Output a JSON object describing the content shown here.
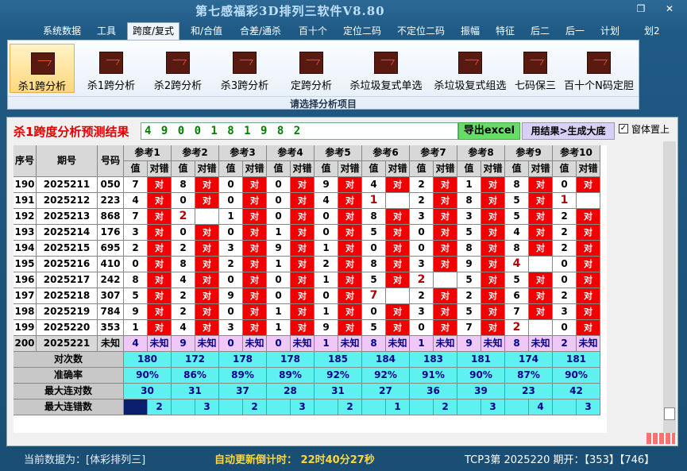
{
  "window": {
    "title": "第七感福彩3D排列三软件V8.80",
    "restore_glyph": "❐",
    "close_glyph": "✕"
  },
  "menu": [
    {
      "label": "系统数据",
      "active": false
    },
    {
      "label": "工具",
      "active": false
    },
    {
      "label": "跨度/复式",
      "active": true
    },
    {
      "label": "和/合值",
      "active": false
    },
    {
      "label": "合差/通杀",
      "active": false
    },
    {
      "label": "百十个",
      "active": false
    },
    {
      "label": "定位二码",
      "active": false
    },
    {
      "label": "不定位二码",
      "active": false
    },
    {
      "label": "振幅",
      "active": false
    },
    {
      "label": "特征",
      "active": false
    },
    {
      "label": "后二",
      "active": false
    },
    {
      "label": "后一",
      "active": false
    },
    {
      "label": "计划",
      "active": false
    },
    {
      "label": "划2",
      "active": false
    }
  ],
  "ribbon": {
    "buttons": [
      "杀1跨分析",
      "杀1跨分析",
      "杀2跨分析",
      "杀3跨分析",
      "定跨分析",
      "杀垃圾复式单选",
      "杀垃圾复式组选",
      "七码保三",
      "百十个N码定胆"
    ],
    "caption": "请选择分析项目"
  },
  "analysis": {
    "title": "杀1跨度分析预测结果",
    "prediction": "4 9 0 0 1 8 1 9 8 2",
    "excel_button": "导出excel",
    "generate_button": "用结果>生成大底",
    "pin_label": "窗体置上",
    "pin_checked": true,
    "pin_checkmark": "✓"
  },
  "table": {
    "headers": {
      "seq": "序号",
      "period": "期号",
      "number": "号码",
      "value": "值",
      "hit": "对错"
    },
    "ref_groups": [
      "参考1",
      "参考2",
      "参考3",
      "参考4",
      "参考5",
      "参考6",
      "参考7",
      "参考8",
      "参考9",
      "参考10"
    ],
    "hit_text": "对",
    "rows": [
      {
        "seq": "190",
        "period": "2025211",
        "num": "050",
        "v": [
          "7",
          "8",
          "0",
          "0",
          "9",
          "4",
          "2",
          "1",
          "8",
          "0"
        ],
        "h": [
          1,
          1,
          1,
          1,
          1,
          1,
          1,
          1,
          1,
          1
        ]
      },
      {
        "seq": "191",
        "period": "2025212",
        "num": "223",
        "v": [
          "4",
          "0",
          "0",
          "0",
          "4",
          "1",
          "2",
          "8",
          "5",
          "1"
        ],
        "h": [
          1,
          1,
          1,
          1,
          1,
          0,
          1,
          1,
          1,
          0
        ]
      },
      {
        "seq": "192",
        "period": "2025213",
        "num": "868",
        "v": [
          "7",
          "2",
          "1",
          "0",
          "0",
          "8",
          "3",
          "3",
          "5",
          "2"
        ],
        "h": [
          1,
          0,
          1,
          1,
          1,
          1,
          1,
          1,
          1,
          1
        ]
      },
      {
        "seq": "193",
        "period": "2025214",
        "num": "176",
        "v": [
          "3",
          "0",
          "0",
          "1",
          "0",
          "5",
          "0",
          "5",
          "4",
          "2"
        ],
        "h": [
          1,
          1,
          1,
          1,
          1,
          1,
          1,
          1,
          1,
          1
        ]
      },
      {
        "seq": "194",
        "period": "2025215",
        "num": "695",
        "v": [
          "2",
          "2",
          "3",
          "9",
          "1",
          "0",
          "0",
          "8",
          "8",
          "2"
        ],
        "h": [
          1,
          1,
          1,
          1,
          1,
          1,
          1,
          1,
          1,
          1
        ]
      },
      {
        "seq": "195",
        "period": "2025216",
        "num": "410",
        "v": [
          "0",
          "8",
          "2",
          "1",
          "2",
          "8",
          "3",
          "9",
          "4",
          "0"
        ],
        "h": [
          1,
          1,
          1,
          1,
          1,
          1,
          1,
          1,
          0,
          1
        ]
      },
      {
        "seq": "196",
        "period": "2025217",
        "num": "242",
        "v": [
          "8",
          "4",
          "0",
          "0",
          "1",
          "5",
          "2",
          "5",
          "5",
          "0"
        ],
        "h": [
          1,
          1,
          1,
          1,
          1,
          1,
          0,
          1,
          1,
          1
        ]
      },
      {
        "seq": "197",
        "period": "2025218",
        "num": "307",
        "v": [
          "5",
          "2",
          "9",
          "0",
          "0",
          "7",
          "2",
          "2",
          "6",
          "2"
        ],
        "h": [
          1,
          1,
          1,
          1,
          1,
          0,
          1,
          1,
          1,
          1
        ]
      },
      {
        "seq": "198",
        "period": "2025219",
        "num": "784",
        "v": [
          "9",
          "2",
          "0",
          "1",
          "1",
          "0",
          "3",
          "5",
          "7",
          "3"
        ],
        "h": [
          1,
          1,
          1,
          1,
          1,
          1,
          1,
          1,
          1,
          1
        ]
      },
      {
        "seq": "199",
        "period": "2025220",
        "num": "353",
        "v": [
          "1",
          "4",
          "3",
          "1",
          "9",
          "5",
          "0",
          "7",
          "2",
          "0"
        ],
        "h": [
          1,
          1,
          1,
          1,
          1,
          1,
          1,
          1,
          0,
          1
        ]
      }
    ],
    "unknown_row": {
      "seq": "200",
      "period": "2025221",
      "num": "未知",
      "v": [
        "4",
        "9",
        "0",
        "0",
        "1",
        "8",
        "1",
        "9",
        "8",
        "2"
      ],
      "unknown_text": "未知"
    },
    "stats": [
      {
        "label": "对次数",
        "values": [
          "180",
          "172",
          "178",
          "178",
          "185",
          "184",
          "183",
          "181",
          "174",
          "181"
        ]
      },
      {
        "label": "准确率",
        "values": [
          "90%",
          "86%",
          "89%",
          "89%",
          "92%",
          "92%",
          "91%",
          "90%",
          "87%",
          "90%"
        ]
      },
      {
        "label": "最大连对数",
        "values": [
          "30",
          "31",
          "37",
          "28",
          "31",
          "27",
          "36",
          "39",
          "23",
          "42"
        ]
      },
      {
        "label": "最大连错数",
        "values": [
          "2",
          "3",
          "2",
          "3",
          "2",
          "1",
          "2",
          "3",
          "4",
          "3"
        ]
      }
    ]
  },
  "status": {
    "current_data": "当前数据为：[体彩排列三]",
    "countdown": "自动更新倒计时： 22时40分27秒",
    "draw": "TCP3第 2025220 期开：【353】【746】"
  }
}
